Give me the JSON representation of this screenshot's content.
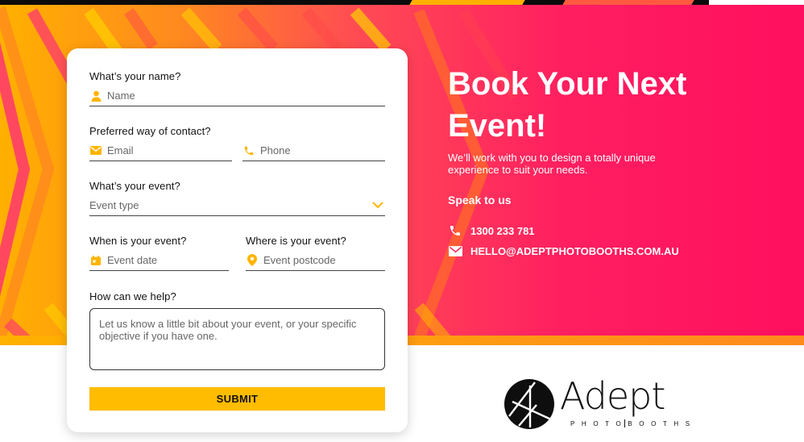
{
  "form": {
    "name_label": "What’s your name?",
    "name_placeholder": "Name",
    "contact_label": "Preferred way of contact?",
    "email_placeholder": "Email",
    "phone_placeholder": "Phone",
    "event_label": "What’s your event?",
    "event_type_placeholder": "Event type",
    "when_label": "When is your event?",
    "event_date_placeholder": "Event date",
    "where_label": "Where is your event?",
    "postcode_placeholder": "Event postcode",
    "help_label": "How can we help?",
    "help_placeholder": "Let us know a little bit about your event, or your specific objective if you have one.",
    "submit_label": "SUBMIT"
  },
  "hero": {
    "headline": "Book Your Next Event!",
    "subtext": "We’ll work with you to design a totally unique experience to suit your needs.",
    "speak_label": "Speak to us",
    "phone": "1300 233 781",
    "email": "HELLO@ADEPTPHOTOBOOTHS.COM.AU"
  },
  "logo": {
    "word": "Adept",
    "sub_left": "PHOTO",
    "sub_right": "BOOTHS"
  },
  "colors": {
    "accent_yellow": "#ffbc00",
    "gradient_start": "#ffb000",
    "gradient_end": "#ff0f5f",
    "icon_yellow": "#ffb400"
  }
}
